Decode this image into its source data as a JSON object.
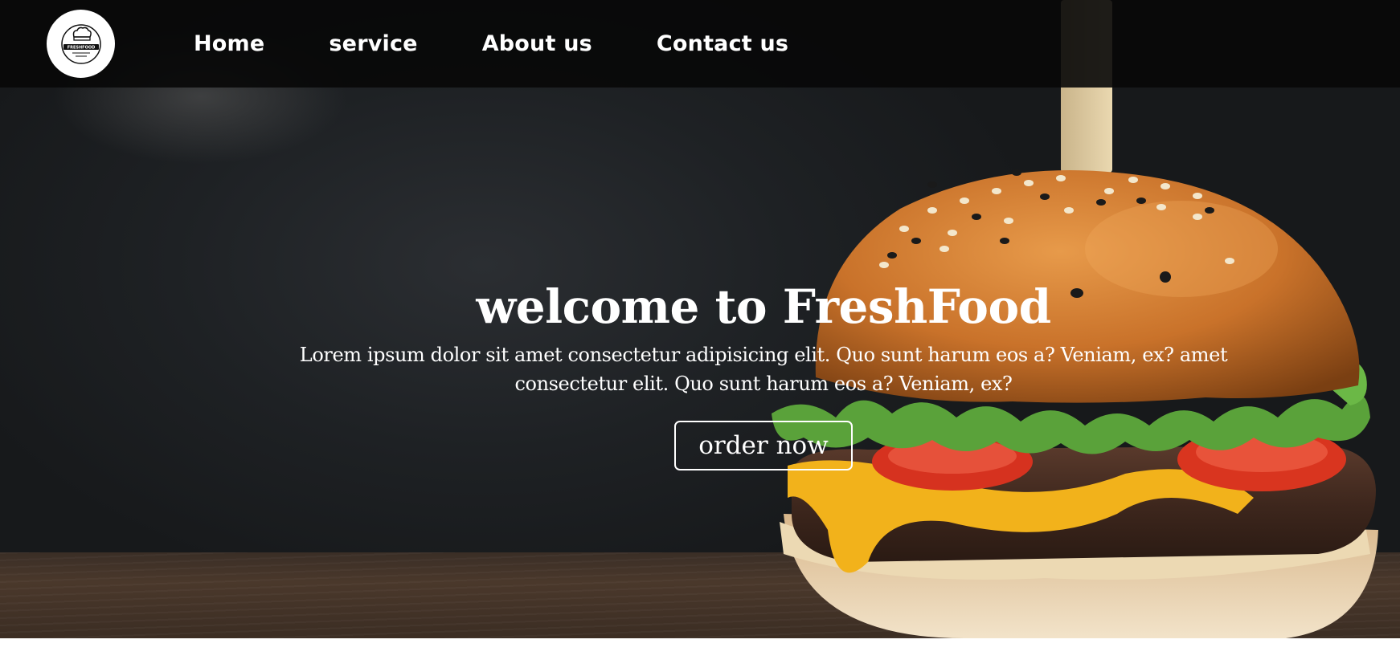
{
  "nav": {
    "logo_text": "FRESHFOOD",
    "links": [
      "Home",
      "service",
      "About us",
      "Contact us"
    ]
  },
  "hero": {
    "title": "welcome to FreshFood",
    "description": "Lorem ipsum dolor sit amet consectetur adipisicing elit. Quo sunt harum eos a? Veniam, ex? amet consectetur elit. Quo sunt harum eos a? Veniam, ex?",
    "button_label": "order now"
  },
  "colors": {
    "navbar_bg": "#080808",
    "text": "#ffffff",
    "button_border": "#ffffff"
  },
  "icons": {
    "logo": "chef-hat-badge-icon"
  }
}
